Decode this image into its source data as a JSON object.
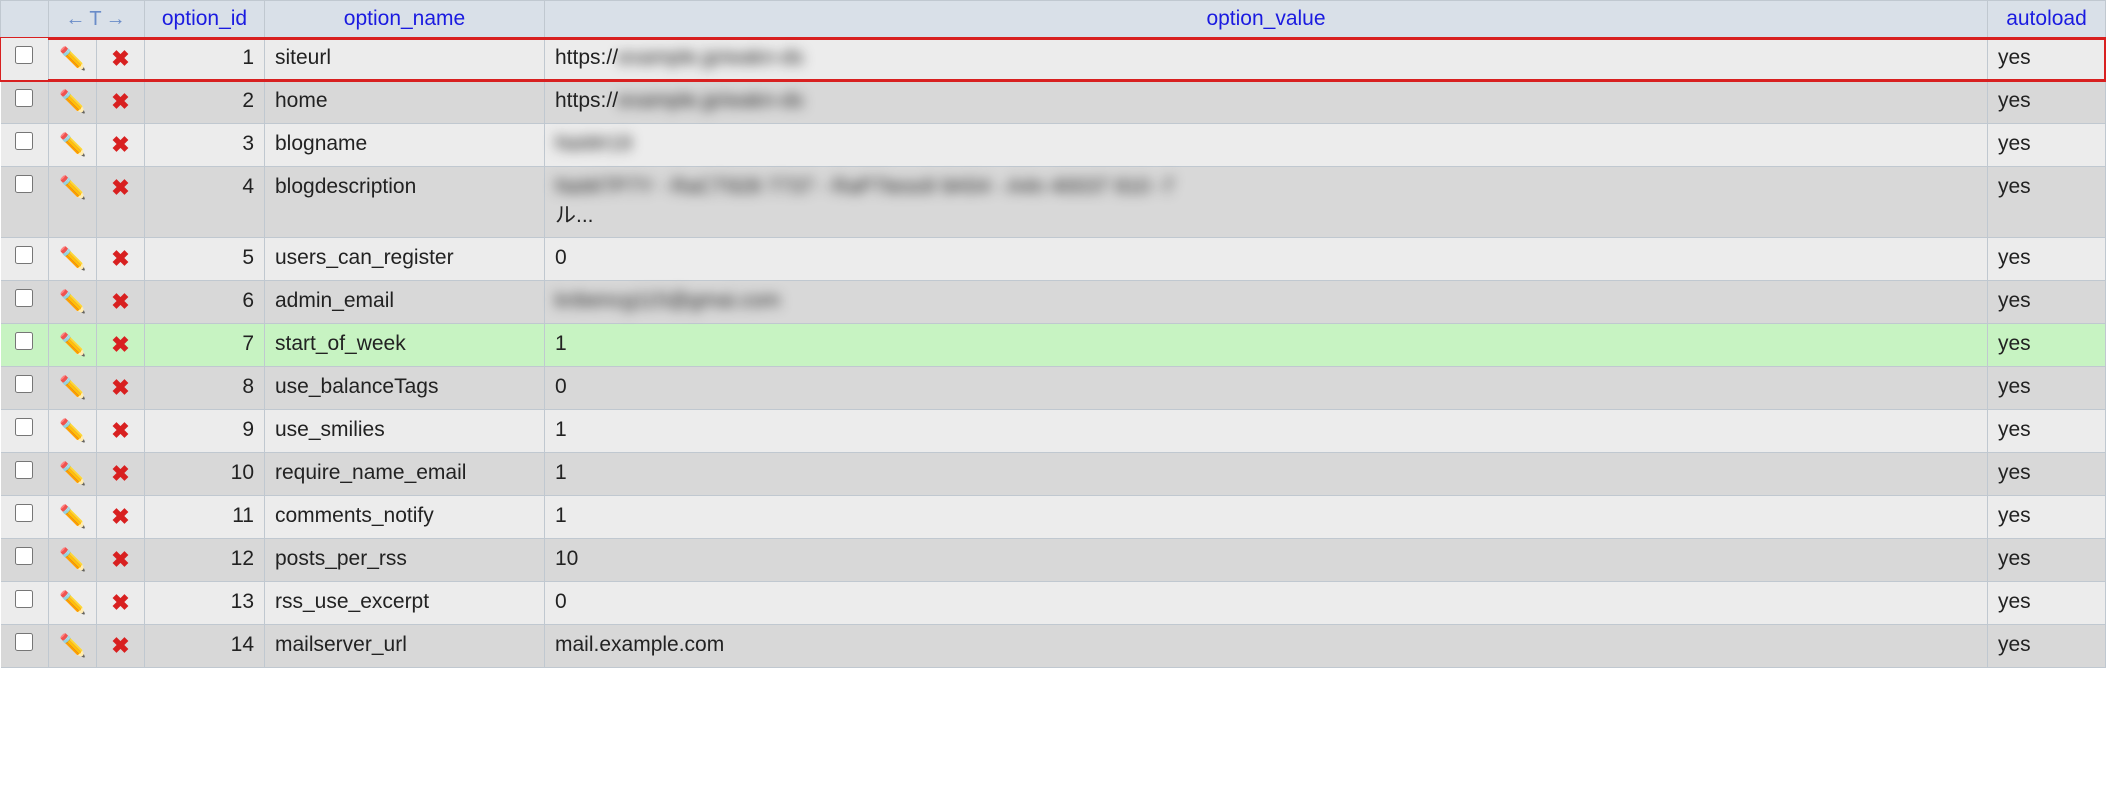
{
  "columns": {
    "option_id": "option_id",
    "option_name": "option_name",
    "option_value": "option_value",
    "autoload": "autoload"
  },
  "rows": [
    {
      "id": "1",
      "name": "siteurl",
      "value_prefix": "https://",
      "value_blur": "example.jp/wakn-ds",
      "value_suffix": "",
      "autoload": "yes",
      "stripe": "odd",
      "highlight": "red"
    },
    {
      "id": "2",
      "name": "home",
      "value_prefix": "https://",
      "value_blur": "example.jp/wakn-ds",
      "value_suffix": "",
      "autoload": "yes",
      "stripe": "even",
      "highlight": ""
    },
    {
      "id": "3",
      "name": "blogname",
      "value_prefix": "",
      "value_blur": "NaWr19",
      "value_suffix": "",
      "autoload": "yes",
      "stripe": "odd",
      "highlight": ""
    },
    {
      "id": "4",
      "name": "blogdescription",
      "value_prefix": "",
      "value_blur": "NaW7P7Y - RaCT928 7737 - RaP7tess9 9A54 - A4n 40037 810 -7",
      "value_suffix": "ル...",
      "autoload": "yes",
      "stripe": "even",
      "highlight": ""
    },
    {
      "id": "5",
      "name": "users_can_register",
      "value_prefix": "0",
      "value_blur": "",
      "value_suffix": "",
      "autoload": "yes",
      "stripe": "odd",
      "highlight": ""
    },
    {
      "id": "6",
      "name": "admin_email",
      "value_prefix": "",
      "value_blur": "knbencg115@gmai.com",
      "value_suffix": "",
      "autoload": "yes",
      "stripe": "even",
      "highlight": ""
    },
    {
      "id": "7",
      "name": "start_of_week",
      "value_prefix": "1",
      "value_blur": "",
      "value_suffix": "",
      "autoload": "yes",
      "stripe": "odd",
      "highlight": "green"
    },
    {
      "id": "8",
      "name": "use_balanceTags",
      "value_prefix": "0",
      "value_blur": "",
      "value_suffix": "",
      "autoload": "yes",
      "stripe": "even",
      "highlight": ""
    },
    {
      "id": "9",
      "name": "use_smilies",
      "value_prefix": "1",
      "value_blur": "",
      "value_suffix": "",
      "autoload": "yes",
      "stripe": "odd",
      "highlight": ""
    },
    {
      "id": "10",
      "name": "require_name_email",
      "value_prefix": "1",
      "value_blur": "",
      "value_suffix": "",
      "autoload": "yes",
      "stripe": "even",
      "highlight": ""
    },
    {
      "id": "11",
      "name": "comments_notify",
      "value_prefix": "1",
      "value_blur": "",
      "value_suffix": "",
      "autoload": "yes",
      "stripe": "odd",
      "highlight": ""
    },
    {
      "id": "12",
      "name": "posts_per_rss",
      "value_prefix": "10",
      "value_blur": "",
      "value_suffix": "",
      "autoload": "yes",
      "stripe": "even",
      "highlight": ""
    },
    {
      "id": "13",
      "name": "rss_use_excerpt",
      "value_prefix": "0",
      "value_blur": "",
      "value_suffix": "",
      "autoload": "yes",
      "stripe": "odd",
      "highlight": ""
    },
    {
      "id": "14",
      "name": "mailserver_url",
      "value_prefix": "mail.example.com",
      "value_blur": "",
      "value_suffix": "",
      "autoload": "yes",
      "stripe": "even",
      "highlight": ""
    }
  ]
}
